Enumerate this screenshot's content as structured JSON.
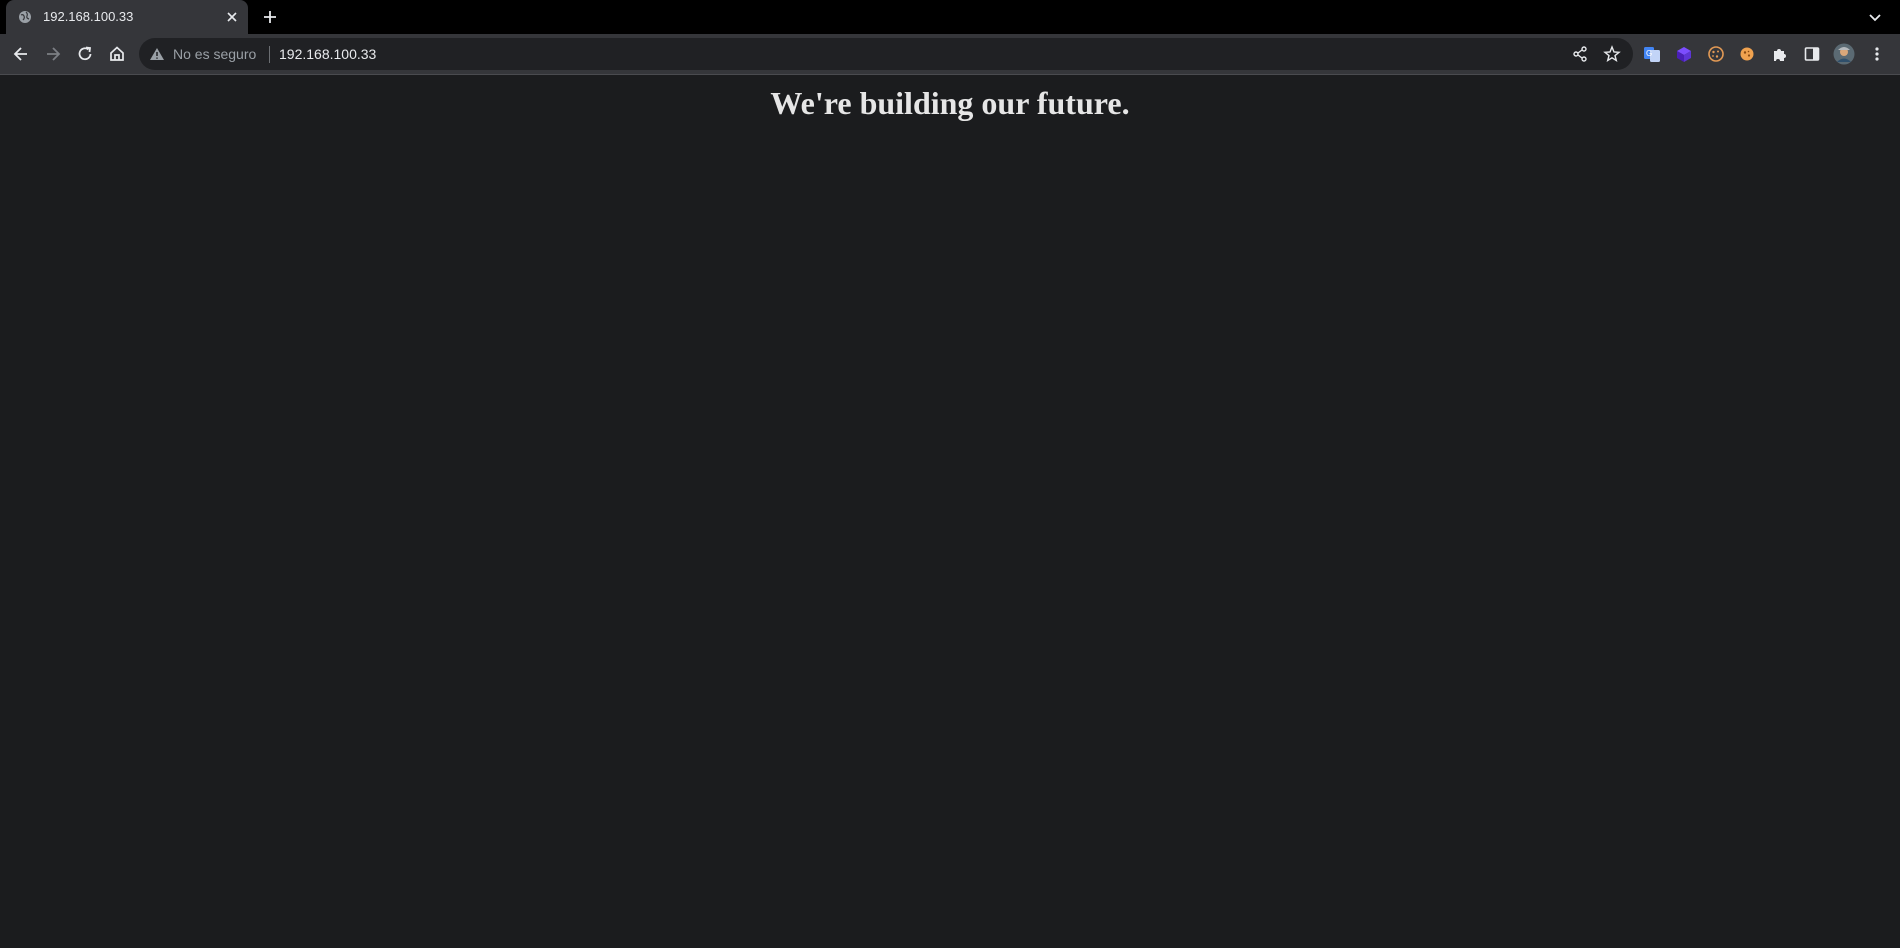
{
  "browser": {
    "tab": {
      "title": "192.168.100.33",
      "favicon": "globe-icon"
    },
    "omnibox": {
      "security_label": "No es seguro",
      "url": "192.168.100.33"
    },
    "icons": {
      "back": "back-arrow-icon",
      "forward": "forward-arrow-icon",
      "reload": "reload-icon",
      "home": "home-icon",
      "share": "share-icon",
      "bookmark": "star-icon",
      "extensions": "puzzle-icon",
      "side_panel": "side-panel-icon"
    }
  },
  "page": {
    "heading": "We're building our future."
  },
  "colors": {
    "tabstrip": "#000000",
    "toolbar": "#35363a",
    "omnibox": "#202124",
    "page_background": "#1b1c1e",
    "heading_text": "#e6e6e6"
  }
}
